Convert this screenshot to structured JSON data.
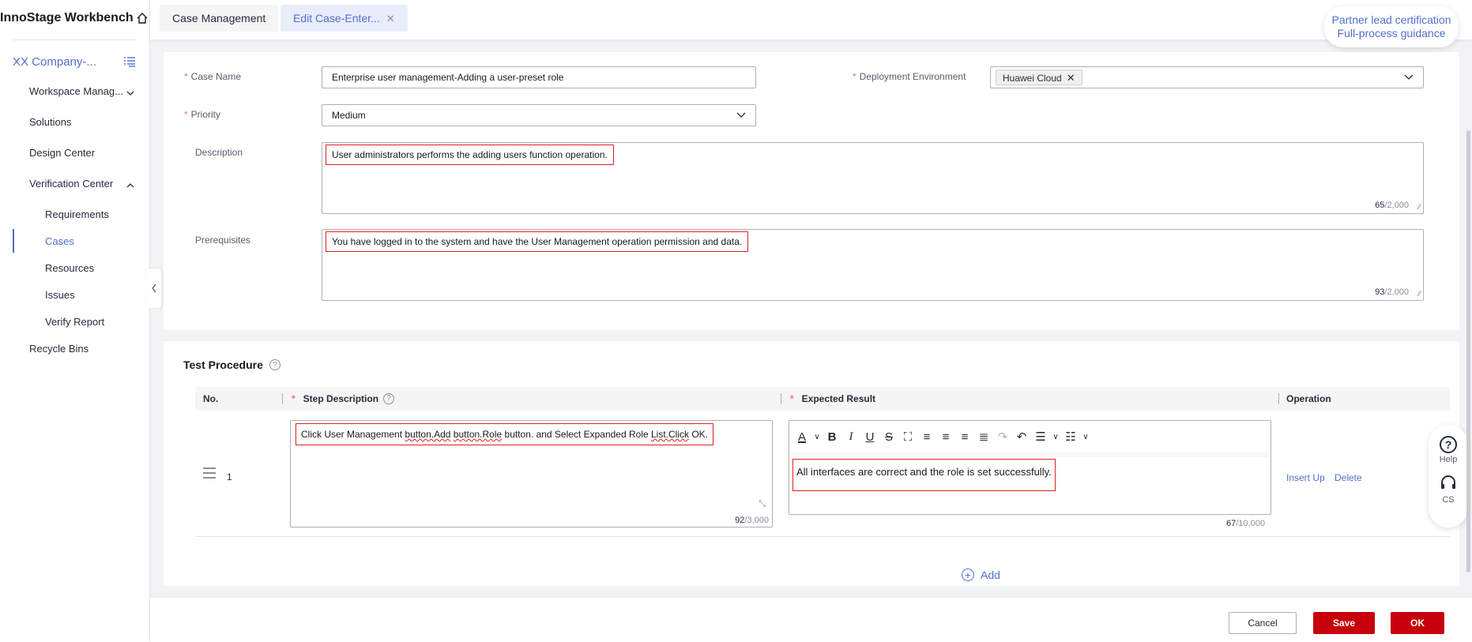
{
  "app": {
    "title": "InnoStage Workbench"
  },
  "sidebar": {
    "company": "XX Company-...",
    "items": [
      {
        "label": "Workspace Manag..."
      },
      {
        "label": "Solutions"
      },
      {
        "label": "Design Center"
      },
      {
        "label": "Verification Center"
      },
      {
        "label": "Requirements"
      },
      {
        "label": "Cases"
      },
      {
        "label": "Resources"
      },
      {
        "label": "Issues"
      },
      {
        "label": "Verify Report"
      },
      {
        "label": "Recycle Bins"
      }
    ]
  },
  "tabs": [
    {
      "label": "Case Management"
    },
    {
      "label": "Edit Case-Enter..."
    }
  ],
  "partner": {
    "line1": "Partner lead certification",
    "line2": "Full-process guidance"
  },
  "form": {
    "case_name": {
      "label": "Case Name",
      "value": "Enterprise user management-Adding a user-preset role"
    },
    "deployment": {
      "label": "Deployment Environment",
      "tag": "Huawei Cloud"
    },
    "priority": {
      "label": "Priority",
      "value": "Medium"
    },
    "description": {
      "label": "Description",
      "value": "User administrators performs the adding users function operation.",
      "count": "65",
      "max": "/2,000"
    },
    "prerequisites": {
      "label": "Prerequisites",
      "value": "You have logged in to the  system and have the User Management operation permission and data.",
      "count": "93",
      "max": "/2,000"
    }
  },
  "procedure": {
    "title": "Test Procedure",
    "headers": {
      "no": "No.",
      "step": "Step Description",
      "expected": "Expected Result",
      "operation": "Operation"
    },
    "rows": [
      {
        "no": "1",
        "step_parts": [
          "Click User Management ",
          "button.Add",
          " ",
          "button.Role",
          " button. and Select Expanded Role ",
          "List.Click",
          " OK."
        ],
        "step_count": "92",
        "step_max": "/3,000",
        "expected": "All interfaces are correct and the role is set successfully.",
        "expected_count": "67",
        "expected_max": "/10,000",
        "insert_up": "Insert Up",
        "delete": "Delete"
      }
    ],
    "add_label": "Add"
  },
  "help": {
    "help_label": "Help",
    "cs_label": "CS"
  },
  "footer": {
    "cancel": "Cancel",
    "save": "Save",
    "ok": "OK"
  },
  "colors": {
    "accent": "#526ecc",
    "primary_button": "#c7000b",
    "required": "#f66f6a",
    "highlight_box": "#e02020"
  }
}
